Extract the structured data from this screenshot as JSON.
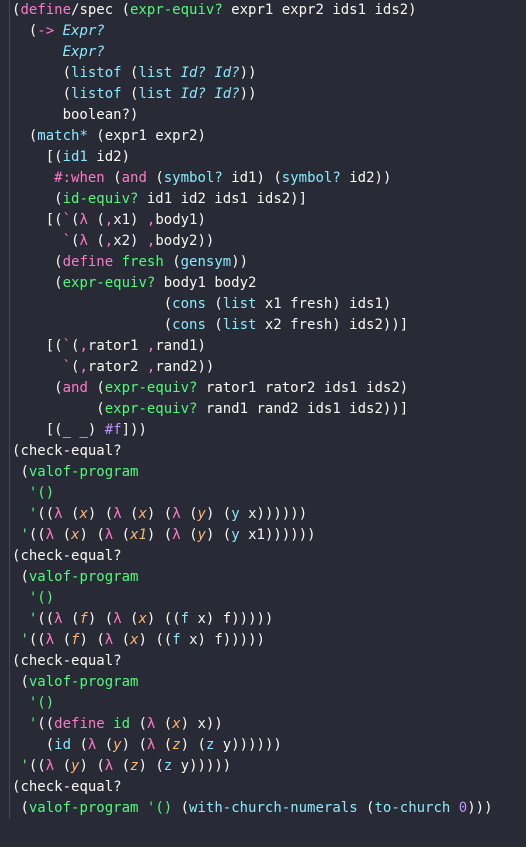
{
  "lines": [
    {
      "indent": 0,
      "spans": [
        {
          "t": "(",
          "c": "c-paren"
        },
        {
          "t": "define",
          "c": "c-def"
        },
        {
          "t": "/spec (",
          "c": "c-paren"
        },
        {
          "t": "expr-equiv?",
          "c": "c-fn"
        },
        {
          "t": " expr1 expr2 ids1 ids2)",
          "c": "c-paren"
        }
      ]
    },
    {
      "indent": 2,
      "spans": [
        {
          "t": "(",
          "c": "c-paren"
        },
        {
          "t": "->",
          "c": "c-op"
        },
        {
          "t": " ",
          "c": ""
        },
        {
          "t": "Expr?",
          "c": "c-type"
        }
      ]
    },
    {
      "indent": 6,
      "spans": [
        {
          "t": "Expr?",
          "c": "c-type"
        }
      ]
    },
    {
      "indent": 6,
      "spans": [
        {
          "t": "(",
          "c": "c-paren"
        },
        {
          "t": "listof",
          "c": "c-call"
        },
        {
          "t": " (",
          "c": "c-paren"
        },
        {
          "t": "list",
          "c": "c-call"
        },
        {
          "t": " ",
          "c": ""
        },
        {
          "t": "Id?",
          "c": "c-type"
        },
        {
          "t": " ",
          "c": ""
        },
        {
          "t": "Id?",
          "c": "c-type"
        },
        {
          "t": "))",
          "c": "c-paren"
        }
      ]
    },
    {
      "indent": 6,
      "spans": [
        {
          "t": "(",
          "c": "c-paren"
        },
        {
          "t": "listof",
          "c": "c-call"
        },
        {
          "t": " (",
          "c": "c-paren"
        },
        {
          "t": "list",
          "c": "c-call"
        },
        {
          "t": " ",
          "c": ""
        },
        {
          "t": "Id?",
          "c": "c-type"
        },
        {
          "t": " ",
          "c": ""
        },
        {
          "t": "Id?",
          "c": "c-type"
        },
        {
          "t": "))",
          "c": "c-paren"
        }
      ]
    },
    {
      "indent": 6,
      "spans": [
        {
          "t": "boolean?",
          "c": "c-id"
        },
        {
          "t": ")",
          "c": "c-paren"
        }
      ]
    },
    {
      "indent": 2,
      "spans": [
        {
          "t": "(",
          "c": "c-paren"
        },
        {
          "t": "match*",
          "c": "c-call"
        },
        {
          "t": " (expr1 expr2)",
          "c": "c-paren"
        }
      ]
    },
    {
      "indent": 4,
      "spans": [
        {
          "t": "[(",
          "c": "c-paren"
        },
        {
          "t": "id1",
          "c": "c-call"
        },
        {
          "t": " id2)",
          "c": "c-paren"
        }
      ]
    },
    {
      "indent": 5,
      "spans": [
        {
          "t": "#:when",
          "c": "c-key"
        },
        {
          "t": " (",
          "c": "c-paren"
        },
        {
          "t": "and",
          "c": "c-kw"
        },
        {
          "t": " (",
          "c": "c-paren"
        },
        {
          "t": "symbol?",
          "c": "c-call"
        },
        {
          "t": " id1) (",
          "c": "c-paren"
        },
        {
          "t": "symbol?",
          "c": "c-call"
        },
        {
          "t": " id2))",
          "c": "c-paren"
        }
      ]
    },
    {
      "indent": 5,
      "spans": [
        {
          "t": "(",
          "c": "c-paren"
        },
        {
          "t": "id-equiv?",
          "c": "c-call2"
        },
        {
          "t": " id1 id2 ids1 ids2)]",
          "c": "c-paren"
        }
      ]
    },
    {
      "indent": 4,
      "spans": [
        {
          "t": "[(",
          "c": "c-paren"
        },
        {
          "t": "`",
          "c": "c-tick"
        },
        {
          "t": "(",
          "c": "c-paren"
        },
        {
          "t": "λ",
          "c": "c-lam"
        },
        {
          "t": " (",
          "c": "c-paren"
        },
        {
          "t": ",",
          "c": "c-comma"
        },
        {
          "t": "x1) ",
          "c": "c-paren"
        },
        {
          "t": ",",
          "c": "c-comma"
        },
        {
          "t": "body1)",
          "c": "c-paren"
        }
      ]
    },
    {
      "indent": 6,
      "spans": [
        {
          "t": "`",
          "c": "c-tick"
        },
        {
          "t": "(",
          "c": "c-paren"
        },
        {
          "t": "λ",
          "c": "c-lam"
        },
        {
          "t": " (",
          "c": "c-paren"
        },
        {
          "t": ",",
          "c": "c-comma"
        },
        {
          "t": "x2) ",
          "c": "c-paren"
        },
        {
          "t": ",",
          "c": "c-comma"
        },
        {
          "t": "body2))",
          "c": "c-paren"
        }
      ]
    },
    {
      "indent": 5,
      "spans": [
        {
          "t": "(",
          "c": "c-paren"
        },
        {
          "t": "define",
          "c": "c-def"
        },
        {
          "t": " ",
          "c": ""
        },
        {
          "t": "fresh",
          "c": "c-fn"
        },
        {
          "t": " (",
          "c": "c-paren"
        },
        {
          "t": "gensym",
          "c": "c-call"
        },
        {
          "t": "))",
          "c": "c-paren"
        }
      ]
    },
    {
      "indent": 5,
      "spans": [
        {
          "t": "(",
          "c": "c-paren"
        },
        {
          "t": "expr-equiv?",
          "c": "c-call2"
        },
        {
          "t": " body1 body2",
          "c": "c-paren"
        }
      ]
    },
    {
      "indent": 18,
      "spans": [
        {
          "t": "(",
          "c": "c-paren"
        },
        {
          "t": "cons",
          "c": "c-call"
        },
        {
          "t": " (",
          "c": "c-paren"
        },
        {
          "t": "list",
          "c": "c-call"
        },
        {
          "t": " x1 fresh) ids1)",
          "c": "c-paren"
        }
      ]
    },
    {
      "indent": 18,
      "spans": [
        {
          "t": "(",
          "c": "c-paren"
        },
        {
          "t": "cons",
          "c": "c-call"
        },
        {
          "t": " (",
          "c": "c-paren"
        },
        {
          "t": "list",
          "c": "c-call"
        },
        {
          "t": " x2 fresh) ids2))]",
          "c": "c-paren"
        }
      ]
    },
    {
      "indent": 4,
      "spans": [
        {
          "t": "[(",
          "c": "c-paren"
        },
        {
          "t": "`",
          "c": "c-tick"
        },
        {
          "t": "(",
          "c": "c-paren"
        },
        {
          "t": ",",
          "c": "c-comma"
        },
        {
          "t": "rator1 ",
          "c": "c-paren"
        },
        {
          "t": ",",
          "c": "c-comma"
        },
        {
          "t": "rand1)",
          "c": "c-paren"
        }
      ]
    },
    {
      "indent": 6,
      "spans": [
        {
          "t": "`",
          "c": "c-tick"
        },
        {
          "t": "(",
          "c": "c-paren"
        },
        {
          "t": ",",
          "c": "c-comma"
        },
        {
          "t": "rator2 ",
          "c": "c-paren"
        },
        {
          "t": ",",
          "c": "c-comma"
        },
        {
          "t": "rand2))",
          "c": "c-paren"
        }
      ]
    },
    {
      "indent": 5,
      "spans": [
        {
          "t": "(",
          "c": "c-paren"
        },
        {
          "t": "and",
          "c": "c-kw"
        },
        {
          "t": " (",
          "c": "c-paren"
        },
        {
          "t": "expr-equiv?",
          "c": "c-call2"
        },
        {
          "t": " rator1 rator2 ids1 ids2)",
          "c": "c-paren"
        }
      ]
    },
    {
      "indent": 10,
      "spans": [
        {
          "t": "(",
          "c": "c-paren"
        },
        {
          "t": "expr-equiv?",
          "c": "c-call2"
        },
        {
          "t": " rand1 rand2 ids1 ids2))]",
          "c": "c-paren"
        }
      ]
    },
    {
      "indent": 4,
      "spans": [
        {
          "t": "[(",
          "c": "c-paren"
        },
        {
          "t": "_",
          "c": "c-id"
        },
        {
          "t": " ",
          "c": ""
        },
        {
          "t": "_",
          "c": "c-id"
        },
        {
          "t": ") ",
          "c": "c-paren"
        },
        {
          "t": "#f",
          "c": "c-const"
        },
        {
          "t": "]))",
          "c": "c-paren"
        }
      ]
    },
    {
      "indent": 0,
      "spans": [
        {
          "t": "",
          "c": ""
        }
      ]
    },
    {
      "indent": 0,
      "spans": [
        {
          "t": "(",
          "c": "c-paren"
        },
        {
          "t": "check-equal?",
          "c": "c-id"
        }
      ]
    },
    {
      "indent": 1,
      "spans": [
        {
          "t": "(",
          "c": "c-paren"
        },
        {
          "t": "valof-program",
          "c": "c-call2"
        }
      ]
    },
    {
      "indent": 2,
      "spans": [
        {
          "t": "'",
          "c": "c-quote"
        },
        {
          "t": "()",
          "c": "c-quote"
        }
      ]
    },
    {
      "indent": 2,
      "spans": [
        {
          "t": "'",
          "c": "c-quote"
        },
        {
          "t": "((",
          "c": "c-paren"
        },
        {
          "t": "λ",
          "c": "c-lam"
        },
        {
          "t": " (",
          "c": "c-paren"
        },
        {
          "t": "x",
          "c": "c-var"
        },
        {
          "t": ") (",
          "c": "c-paren"
        },
        {
          "t": "λ",
          "c": "c-lam"
        },
        {
          "t": " (",
          "c": "c-paren"
        },
        {
          "t": "x",
          "c": "c-var"
        },
        {
          "t": ") (",
          "c": "c-paren"
        },
        {
          "t": "λ",
          "c": "c-lam"
        },
        {
          "t": " (",
          "c": "c-paren"
        },
        {
          "t": "y",
          "c": "c-var"
        },
        {
          "t": ") (",
          "c": "c-paren"
        },
        {
          "t": "y",
          "c": "c-call"
        },
        {
          "t": " x))))))",
          "c": "c-paren"
        }
      ]
    },
    {
      "indent": 1,
      "spans": [
        {
          "t": "'",
          "c": "c-quote"
        },
        {
          "t": "((",
          "c": "c-paren"
        },
        {
          "t": "λ",
          "c": "c-lam"
        },
        {
          "t": " (",
          "c": "c-paren"
        },
        {
          "t": "x",
          "c": "c-var"
        },
        {
          "t": ") (",
          "c": "c-paren"
        },
        {
          "t": "λ",
          "c": "c-lam"
        },
        {
          "t": " (",
          "c": "c-paren"
        },
        {
          "t": "x1",
          "c": "c-var"
        },
        {
          "t": ") (",
          "c": "c-paren"
        },
        {
          "t": "λ",
          "c": "c-lam"
        },
        {
          "t": " (",
          "c": "c-paren"
        },
        {
          "t": "y",
          "c": "c-var"
        },
        {
          "t": ") (",
          "c": "c-paren"
        },
        {
          "t": "y",
          "c": "c-call"
        },
        {
          "t": " x1))))))",
          "c": "c-paren"
        }
      ]
    },
    {
      "indent": 0,
      "spans": [
        {
          "t": "(",
          "c": "c-paren"
        },
        {
          "t": "check-equal?",
          "c": "c-id"
        }
      ]
    },
    {
      "indent": 1,
      "spans": [
        {
          "t": "(",
          "c": "c-paren"
        },
        {
          "t": "valof-program",
          "c": "c-call2"
        }
      ]
    },
    {
      "indent": 2,
      "spans": [
        {
          "t": "'",
          "c": "c-quote"
        },
        {
          "t": "()",
          "c": "c-quote"
        }
      ]
    },
    {
      "indent": 2,
      "spans": [
        {
          "t": "'",
          "c": "c-quote"
        },
        {
          "t": "((",
          "c": "c-paren"
        },
        {
          "t": "λ",
          "c": "c-lam"
        },
        {
          "t": " (",
          "c": "c-paren"
        },
        {
          "t": "f",
          "c": "c-var"
        },
        {
          "t": ") (",
          "c": "c-paren"
        },
        {
          "t": "λ",
          "c": "c-lam"
        },
        {
          "t": " (",
          "c": "c-paren"
        },
        {
          "t": "x",
          "c": "c-var"
        },
        {
          "t": ") ((",
          "c": "c-paren"
        },
        {
          "t": "f",
          "c": "c-call"
        },
        {
          "t": " x) f)))))",
          "c": "c-paren"
        }
      ]
    },
    {
      "indent": 1,
      "spans": [
        {
          "t": "'",
          "c": "c-quote"
        },
        {
          "t": "((",
          "c": "c-paren"
        },
        {
          "t": "λ",
          "c": "c-lam"
        },
        {
          "t": " (",
          "c": "c-paren"
        },
        {
          "t": "f",
          "c": "c-var"
        },
        {
          "t": ") (",
          "c": "c-paren"
        },
        {
          "t": "λ",
          "c": "c-lam"
        },
        {
          "t": " (",
          "c": "c-paren"
        },
        {
          "t": "x",
          "c": "c-var"
        },
        {
          "t": ") ((",
          "c": "c-paren"
        },
        {
          "t": "f",
          "c": "c-call"
        },
        {
          "t": " x) f)))))",
          "c": "c-paren"
        }
      ]
    },
    {
      "indent": 0,
      "spans": [
        {
          "t": "(",
          "c": "c-paren"
        },
        {
          "t": "check-equal?",
          "c": "c-id"
        }
      ]
    },
    {
      "indent": 1,
      "spans": [
        {
          "t": "(",
          "c": "c-paren"
        },
        {
          "t": "valof-program",
          "c": "c-call2"
        }
      ]
    },
    {
      "indent": 2,
      "spans": [
        {
          "t": "'",
          "c": "c-quote"
        },
        {
          "t": "()",
          "c": "c-quote"
        }
      ]
    },
    {
      "indent": 2,
      "spans": [
        {
          "t": "'",
          "c": "c-quote"
        },
        {
          "t": "((",
          "c": "c-paren"
        },
        {
          "t": "define",
          "c": "c-def"
        },
        {
          "t": " ",
          "c": ""
        },
        {
          "t": "id",
          "c": "c-fn"
        },
        {
          "t": " (",
          "c": "c-paren"
        },
        {
          "t": "λ",
          "c": "c-lam"
        },
        {
          "t": " (",
          "c": "c-paren"
        },
        {
          "t": "x",
          "c": "c-var"
        },
        {
          "t": ") x))",
          "c": "c-paren"
        }
      ]
    },
    {
      "indent": 4,
      "spans": [
        {
          "t": "(",
          "c": "c-paren"
        },
        {
          "t": "id",
          "c": "c-call"
        },
        {
          "t": " (",
          "c": "c-paren"
        },
        {
          "t": "λ",
          "c": "c-lam"
        },
        {
          "t": " (",
          "c": "c-paren"
        },
        {
          "t": "y",
          "c": "c-var"
        },
        {
          "t": ") (",
          "c": "c-paren"
        },
        {
          "t": "λ",
          "c": "c-lam"
        },
        {
          "t": " (",
          "c": "c-paren"
        },
        {
          "t": "z",
          "c": "c-var"
        },
        {
          "t": ") (",
          "c": "c-paren"
        },
        {
          "t": "z",
          "c": "c-call"
        },
        {
          "t": " y))))))",
          "c": "c-paren"
        }
      ]
    },
    {
      "indent": 1,
      "spans": [
        {
          "t": "'",
          "c": "c-quote"
        },
        {
          "t": "((",
          "c": "c-paren"
        },
        {
          "t": "λ",
          "c": "c-lam"
        },
        {
          "t": " (",
          "c": "c-paren"
        },
        {
          "t": "y",
          "c": "c-var"
        },
        {
          "t": ") (",
          "c": "c-paren"
        },
        {
          "t": "λ",
          "c": "c-lam"
        },
        {
          "t": " (",
          "c": "c-paren"
        },
        {
          "t": "z",
          "c": "c-var"
        },
        {
          "t": ") (",
          "c": "c-paren"
        },
        {
          "t": "z",
          "c": "c-call"
        },
        {
          "t": " y)))))",
          "c": "c-paren"
        }
      ]
    },
    {
      "indent": 0,
      "spans": [
        {
          "t": "(",
          "c": "c-paren"
        },
        {
          "t": "check-equal?",
          "c": "c-id"
        }
      ]
    },
    {
      "indent": 1,
      "spans": [
        {
          "t": "(",
          "c": "c-paren"
        },
        {
          "t": "valof-program",
          "c": "c-call2"
        },
        {
          "t": " ",
          "c": ""
        },
        {
          "t": "'",
          "c": "c-quote"
        },
        {
          "t": "()",
          "c": "c-quote"
        },
        {
          "t": " (",
          "c": "c-paren"
        },
        {
          "t": "with-church-numerals",
          "c": "c-call"
        },
        {
          "t": " (",
          "c": "c-paren"
        },
        {
          "t": "to-church",
          "c": "c-call"
        },
        {
          "t": " ",
          "c": ""
        },
        {
          "t": "0",
          "c": "c-num"
        },
        {
          "t": ")))",
          "c": "c-paren"
        }
      ]
    }
  ]
}
